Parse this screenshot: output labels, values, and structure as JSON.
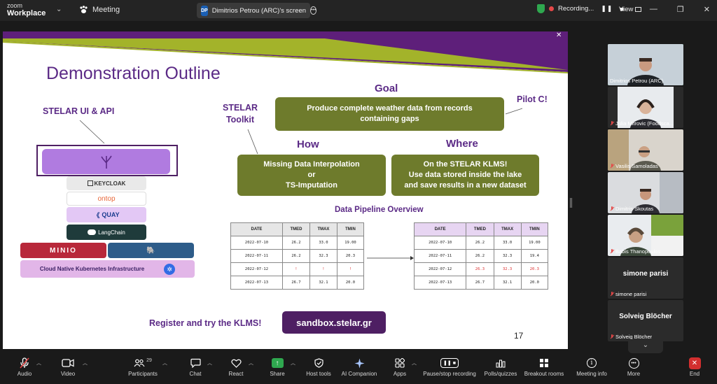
{
  "app": {
    "brand_line1": "zoom",
    "brand_line2": "Workplace",
    "meeting_label": "Meeting",
    "share_initials": "DP",
    "share_tab_title": "Dimitrios Petrou (ARC)'s screen",
    "recording_label": "Recording...",
    "view_label": "View"
  },
  "slide": {
    "title": "Demonstration Outline",
    "stelar_ui": "STELAR UI & API",
    "stelar_toolkit_l1": "STELAR",
    "stelar_toolkit_l2": "Toolkit",
    "goal": "Goal",
    "goal_text_l1": "Produce complete weather data from records",
    "goal_text_l2": "containing gaps",
    "pilot": "Pilot C!",
    "how": "How",
    "how_text_l1": "Missing Data Interpolation",
    "how_text_l2": "or",
    "how_text_l3": "TS-Imputation",
    "where": "Where",
    "where_text_l1_pre": "On the ",
    "where_text_l1_bold": "STELAR KLMS!",
    "where_text_l2": "Use data stored inside the lake",
    "where_text_l3": "and save results in a new dataset",
    "stack": {
      "keycloak": "KEYCLOAK",
      "ontop": "ontop",
      "quay": "QUAY",
      "langchain": "LangChain",
      "minio": "MINIO",
      "k8s": "Cloud Native Kubernetes Infrastructure"
    },
    "pipeline_title": "Data Pipeline Overview",
    "table_headers": [
      "DATE",
      "TMED",
      "TMAX",
      "TMIN"
    ],
    "table_left": [
      [
        "2022-07-10",
        "26.2",
        "33.0",
        "19.00"
      ],
      [
        "2022-07-11",
        "26.2",
        "32.3",
        "20.3"
      ],
      [
        "2022-07-12",
        "!",
        "!",
        "!"
      ],
      [
        "2022-07-13",
        "26.7",
        "32.1",
        "20.0"
      ]
    ],
    "table_right": [
      [
        "2022-07-10",
        "26.2",
        "33.0",
        "19.00"
      ],
      [
        "2022-07-11",
        "26.2",
        "32.3",
        "19.4"
      ],
      [
        "2022-07-12",
        "26.3",
        "32.3",
        "20.3"
      ],
      [
        "2022-07-13",
        "26.7",
        "32.1",
        "20.0"
      ]
    ],
    "register": "Register and try the KLMS!",
    "sandbox": "sandbox.stelar.gr",
    "page_number": "17"
  },
  "participants": [
    {
      "name": "Dimitrios Petrou (ARC)",
      "muted": false,
      "video": true
    },
    {
      "name": "Julia Mitrovic (Foodsca...",
      "muted": true,
      "video": true
    },
    {
      "name": "Vasilis Samoladas",
      "muted": true,
      "video": true
    },
    {
      "name": "Dimitris Skoutas",
      "muted": true,
      "video": true
    },
    {
      "name": "Babis Thanopoulos",
      "muted": true,
      "video": true
    },
    {
      "name": "simone parisi",
      "display": "simone parisi",
      "muted": true,
      "video": false
    },
    {
      "name": "Solveig Blöcher",
      "display": "Solveig Blöcher",
      "muted": true,
      "video": false
    }
  ],
  "toolbar": {
    "audio": "Audio",
    "video": "Video",
    "participants": "Participants",
    "participants_count": "29",
    "chat": "Chat",
    "react": "React",
    "share": "Share",
    "host_tools": "Host tools",
    "ai_companion": "AI Companion",
    "apps": "Apps",
    "pause_stop": "Pause/stop recording",
    "polls": "Polls/quizzes",
    "breakout": "Breakout rooms",
    "meeting_info": "Meeting info",
    "more": "More",
    "end": "End"
  }
}
